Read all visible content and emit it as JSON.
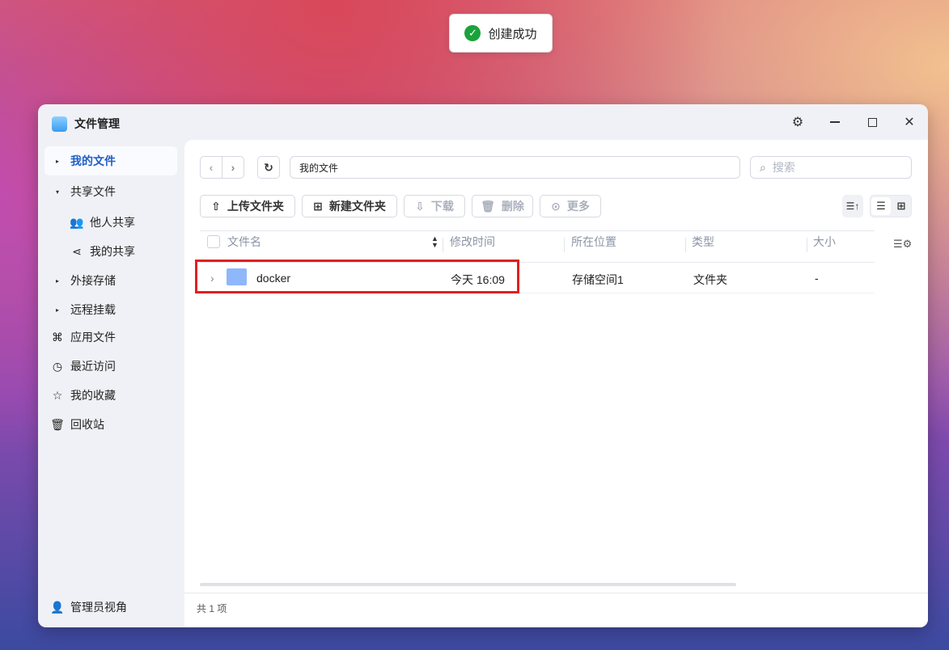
{
  "toast": {
    "message": "创建成功",
    "icon": "check-circle-icon",
    "color": "#1aa33a"
  },
  "window": {
    "title": "文件管理"
  },
  "sidebar": {
    "items": [
      {
        "label": "我的文件",
        "active": true
      },
      {
        "label": "共享文件"
      },
      {
        "label": "他人共享"
      },
      {
        "label": "我的共享"
      },
      {
        "label": "外接存储"
      },
      {
        "label": "远程挂载"
      },
      {
        "label": "应用文件"
      },
      {
        "label": "最近访问"
      },
      {
        "label": "我的收藏"
      },
      {
        "label": "回收站"
      }
    ],
    "footer": "管理员视角"
  },
  "toolbar": {
    "path": "我的文件",
    "search_placeholder": "搜索",
    "upload": "上传文件夹",
    "new_folder": "新建文件夹",
    "download": "下载",
    "delete": "删除",
    "more": "更多"
  },
  "table": {
    "headers": [
      "文件名",
      "修改时间",
      "所在位置",
      "类型",
      "大小"
    ],
    "rows": [
      {
        "name": "docker",
        "modified": "今天 16:09",
        "location": "存储空间1",
        "type": "文件夹",
        "size": "-"
      }
    ]
  },
  "status": "共 1 项",
  "accent": "#1f5fc4",
  "highlight": "#e02020"
}
